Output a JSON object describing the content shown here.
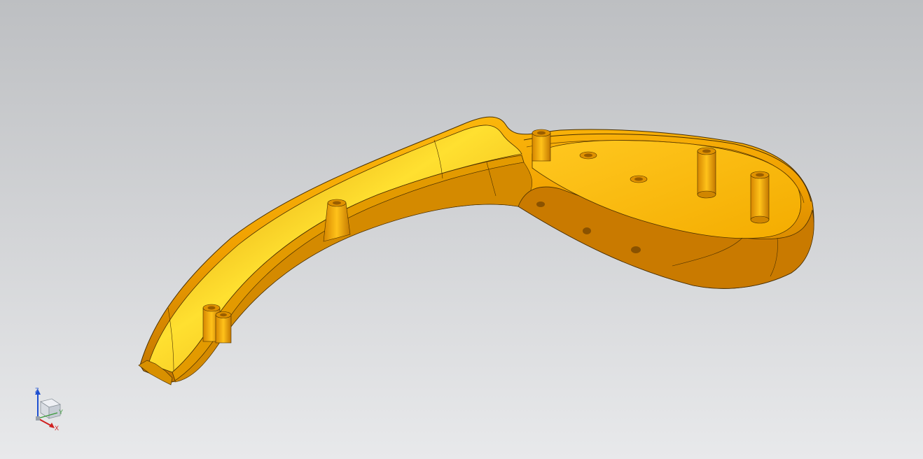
{
  "viewport": {
    "background_top": "#bdbfc2",
    "background_bottom": "#e8e9eb"
  },
  "model": {
    "body_color": "#f2a200",
    "shadow_color": "#b06a00",
    "highlight_color": "#ffd21a",
    "edge_color": "#4a3000"
  },
  "triad": {
    "z_label": "Z",
    "y_label": "Y",
    "x_label": "X",
    "z_color": "#1d4fd0",
    "y_color": "#3a9a3a",
    "x_color": "#d02020"
  }
}
